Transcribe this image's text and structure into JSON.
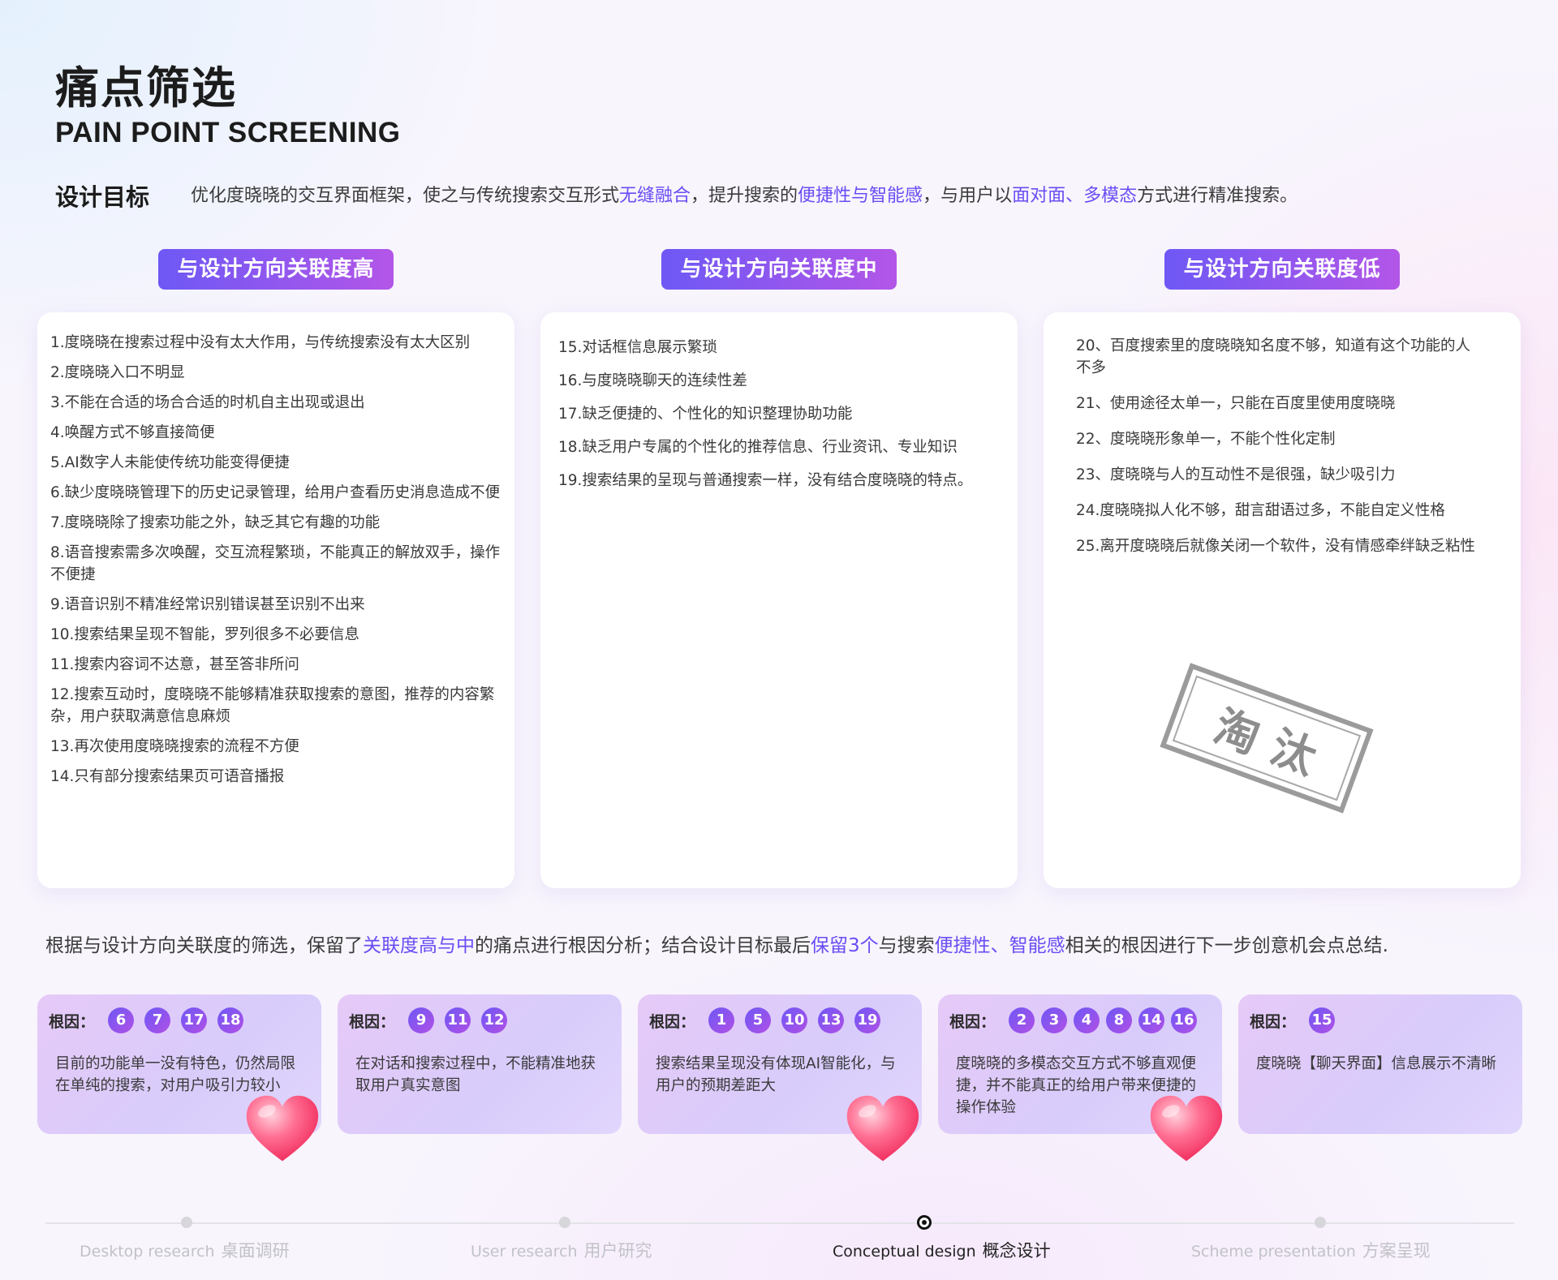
{
  "title_cn": "痛点筛选",
  "title_en": "PAIN POINT SCREENING",
  "goal": {
    "label": "设计目标",
    "parts": [
      "优化度晓晓的交互界面框架，使之与传统搜索交互形式",
      "无缝融合",
      "，提升搜索的",
      "便捷性与智能感",
      "，与用户以",
      "面对面、多模态",
      "方式进行精准搜索。"
    ]
  },
  "columns": [
    {
      "tag": "与设计方向关联度高",
      "items": [
        "1.度晓晓在搜索过程中没有太大作用，与传统搜索没有太大区别",
        "2.度晓晓入口不明显",
        "3.不能在合适的场合合适的时机自主出现或退出",
        "4.唤醒方式不够直接简便",
        "5.AI数字人未能使传统功能变得便捷",
        "6.缺少度晓晓管理下的历史记录管理，给用户查看历史消息造成不便",
        "7.度晓晓除了搜索功能之外，缺乏其它有趣的功能",
        "8.语音搜索需多次唤醒，交互流程繁琐，不能真正的解放双手，操作不便捷",
        "9.语音识别不精准经常识别错误甚至识别不出来",
        "10.搜索结果呈现不智能，罗列很多不必要信息",
        "11.搜索内容词不达意，甚至答非所问",
        "12.搜索互动时，度晓晓不能够精准获取搜索的意图，推荐的内容繁杂，用户获取满意信息麻烦",
        "13.再次使用度晓晓搜索的流程不方便",
        "14.只有部分搜索结果页可语音播报"
      ]
    },
    {
      "tag": "与设计方向关联度中",
      "items": [
        "15.对话框信息展示繁琐",
        "16.与度晓晓聊天的连续性差",
        "17.缺乏便捷的、个性化的知识整理协助功能",
        "18.缺乏用户专属的个性化的推荐信息、行业资讯、专业知识",
        "19.搜索结果的呈现与普通搜索一样，没有结合度晓晓的特点。"
      ]
    },
    {
      "tag": "与设计方向关联度低",
      "items": [
        "20、百度搜索里的度晓晓知名度不够，知道有这个功能的人不多",
        "21、使用途径太单一，只能在百度里使用度晓晓",
        "22、度晓晓形象单一，不能个性化定制",
        "23、度晓晓与人的互动性不是很强，缺少吸引力",
        "24.度晓晓拟人化不够，甜言甜语过多，不能自定义性格",
        "25.离开度晓晓后就像关闭一个软件，没有情感牵绊缺乏粘性"
      ],
      "stamp": "淘汰"
    }
  ],
  "summary": {
    "parts": [
      "根据与设计方向关联度的筛选，保留了",
      "关联度高与中",
      "的痛点进行根因分析；结合设计目标最后",
      "保留3个",
      "与搜索",
      "便捷性、智能感",
      "相关的根因进行下一步创意机会点总结."
    ]
  },
  "roots": [
    {
      "label": "根因：",
      "badges": [
        "6",
        "7",
        "17",
        "18"
      ],
      "text": "目前的功能单一没有特色，仍然局限在单纯的搜索，对用户吸引力较小",
      "kept": true
    },
    {
      "label": "根因：",
      "badges": [
        "9",
        "11",
        "12"
      ],
      "text": "在对话和搜索过程中，不能精准地获取用户真实意图",
      "kept": false
    },
    {
      "label": "根因：",
      "badges": [
        "1",
        "5",
        "10",
        "13",
        "19"
      ],
      "text": "搜索结果呈现没有体现AI智能化，与用户的预期差距大",
      "kept": true
    },
    {
      "label": "根因：",
      "badges": [
        "2",
        "3",
        "4",
        "8",
        "14",
        "16"
      ],
      "text": "度晓晓的多模态交互方式不够直观便捷，并不能真正的给用户带来便捷的操作体验",
      "kept": true
    },
    {
      "label": "根因：",
      "badges": [
        "15"
      ],
      "text": "度晓晓【聊天界面】信息展示不清晰",
      "kept": false
    }
  ],
  "timeline": [
    {
      "en": "Desktop research",
      "cn": "桌面调研",
      "active": false
    },
    {
      "en": "User research",
      "cn": "用户研究",
      "active": false
    },
    {
      "en": "Conceptual design",
      "cn": "概念设计",
      "active": true
    },
    {
      "en": "Scheme presentation",
      "cn": "方案呈现",
      "active": false
    }
  ],
  "colors": {
    "accent": "#6a4df4",
    "tag_gradient_start": "#6e58f5",
    "tag_gradient_end": "#b356e8",
    "root_card": "#dccbf9",
    "heart": "#ff4f7a"
  },
  "icons": {
    "kept_marker": "heart-icon",
    "stamp": "rejected-stamp"
  }
}
